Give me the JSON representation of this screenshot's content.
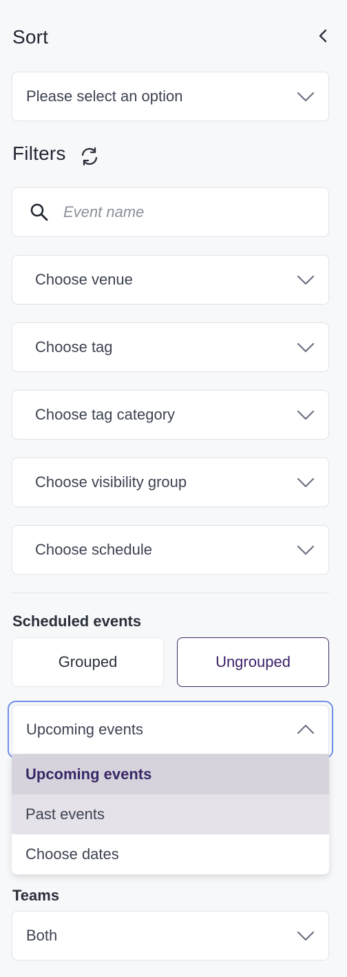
{
  "sort": {
    "title": "Sort",
    "select_placeholder": "Please select an option"
  },
  "filters": {
    "title": "Filters",
    "search_placeholder": "Event name",
    "venue": "Choose venue",
    "tag": "Choose tag",
    "tag_category": "Choose tag category",
    "visibility_group": "Choose visibility group",
    "schedule": "Choose schedule"
  },
  "scheduled": {
    "label": "Scheduled events",
    "grouped": "Grouped",
    "ungrouped": "Ungrouped",
    "active_mode": "Ungrouped"
  },
  "time_select": {
    "value": "Upcoming events",
    "options": [
      "Upcoming events",
      "Past events",
      "Choose dates"
    ],
    "selected_index": 0
  },
  "teams": {
    "label": "Teams",
    "value": "Both"
  },
  "colors": {
    "accent": "#3b2068",
    "focus_ring": "#6e8de6",
    "selected_option_bg": "#d6d3dd",
    "hover_option_bg": "#e6e2ea"
  },
  "icons": {
    "collapse": "chevron-left-icon",
    "dropdown": "chevron-down-icon",
    "dropdown_open": "chevron-up-icon",
    "reset": "refresh-icon",
    "search": "search-icon"
  }
}
